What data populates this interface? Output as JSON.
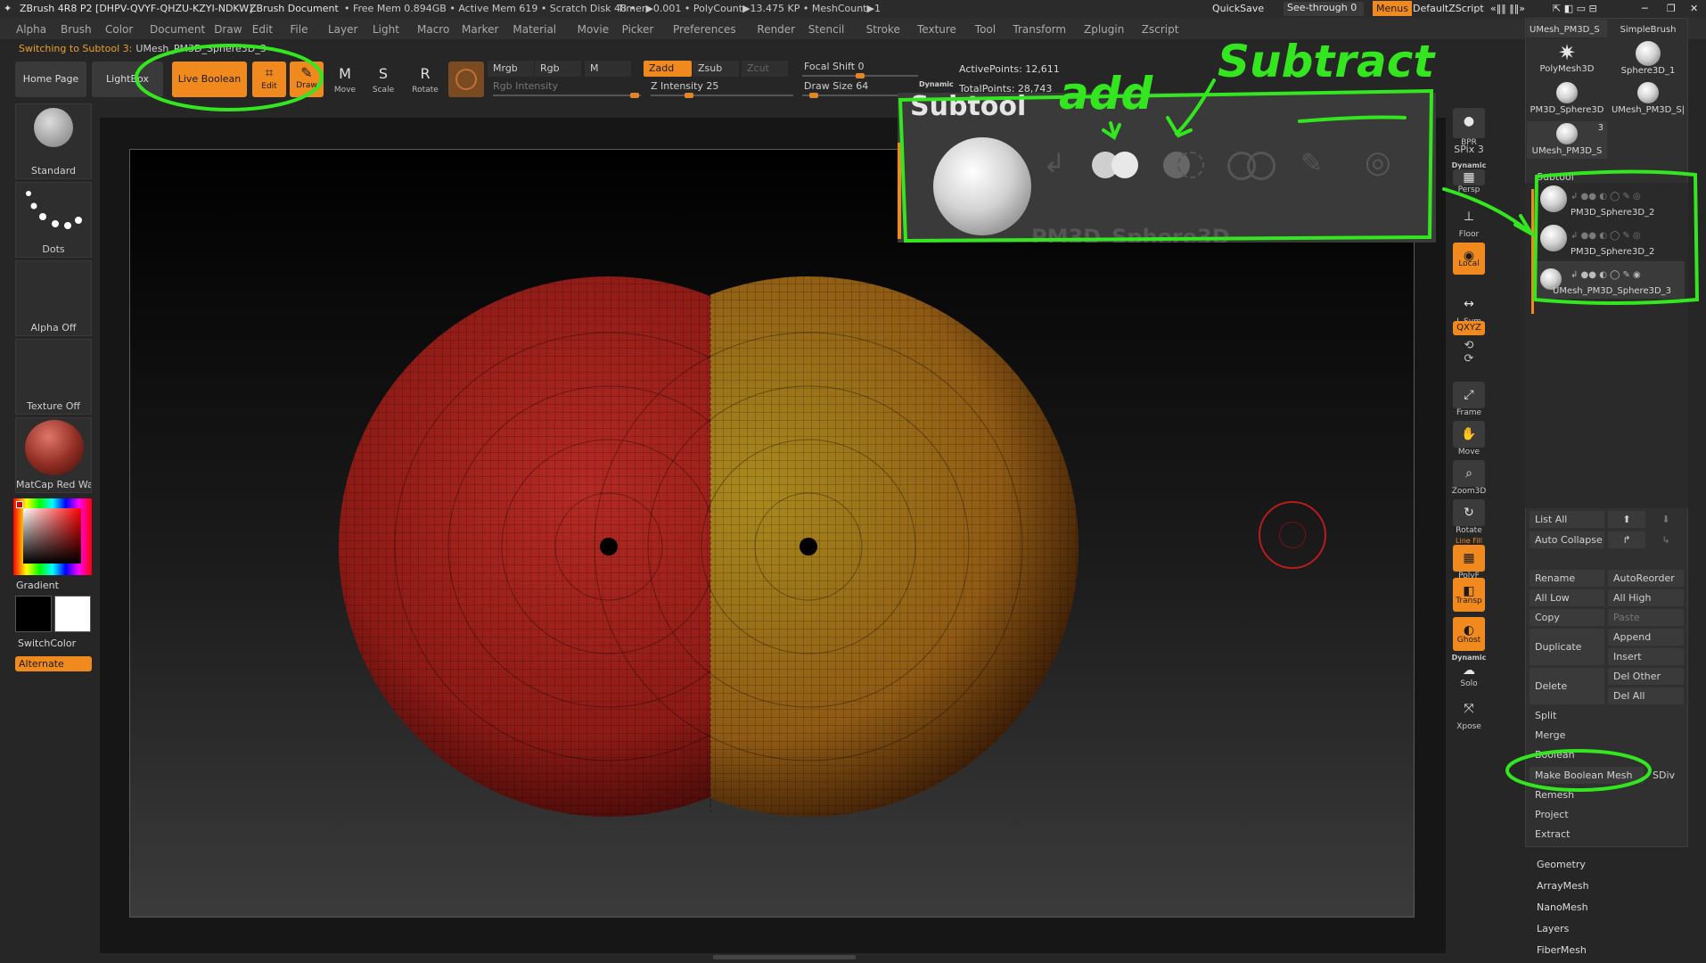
{
  "titlebar": {
    "app": "ZBrush 4R8 P2 [DHPV-QVYF-QHZU-KZYI-NDKW]",
    "doc": "ZBrush Document",
    "stats": "• Free Mem 0.894GB • Active Mem 619 • Scratch Disk 48 •",
    "timer": "Timer▶0.001 • PolyCount▶13.475 KP • MeshCount▶1",
    "quicksave": "QuickSave",
    "see_through": "See-through  0",
    "menus": "Menus",
    "default_zscript": "DefaultZScript"
  },
  "menubar": [
    "Alpha",
    "Brush",
    "Color",
    "Document",
    "Draw",
    "Edit",
    "File",
    "Layer",
    "Light",
    "Macro",
    "Marker",
    "Material",
    "Movie",
    "Picker",
    "Preferences",
    "Render",
    "Stencil",
    "Stroke",
    "Texture",
    "Tool",
    "Transform",
    "Zplugin",
    "Zscript"
  ],
  "notify": {
    "text": "Switching to Subtool 3:",
    "name": "UMesh_PM3D_Sphere3D_3"
  },
  "shelf": {
    "home_page": "Home Page",
    "lightbox": "LightBox",
    "live_boolean": "Live Boolean",
    "edit": "Edit",
    "draw": "Draw",
    "move": "Move",
    "scale": "Scale",
    "rotate": "Rotate",
    "mrgb": "Mrgb",
    "rgb": "Rgb",
    "m": "M",
    "rgb_intensity": "Rgb Intensity",
    "zadd": "Zadd",
    "zsub": "Zsub",
    "zcut": "Zcut",
    "z_intensity": "Z Intensity 25",
    "focal_shift": "Focal Shift 0",
    "draw_size": "Draw Size 64",
    "dynamic": "Dynamic",
    "active_points": "ActivePoints: 12,611",
    "total_points": "TotalPoints: 28,743",
    "z_intensity_value": 25,
    "focal_shift_value": 0,
    "draw_size_value": 64
  },
  "left_tray": {
    "brush": "Standard",
    "stroke": "Dots",
    "alpha": "Alpha Off",
    "texture": "Texture Off",
    "material": "MatCap Red Wa:",
    "gradient": "Gradient",
    "switch_color": "SwitchColor",
    "alternate": "Alternate"
  },
  "right_shelf": {
    "bpr": "BPR",
    "spix": "SPix 3",
    "dynamic": "Dynamic",
    "persp": "Persp",
    "floor": "Floor",
    "local": "Local",
    "lsym": "L.Sym",
    "xyz": "QXYZ",
    "frame": "Frame",
    "move": "Move",
    "zoom3d": "Zoom3D",
    "rotate": "Rotate",
    "linefill": "Line Fill",
    "polyf": "PolyF",
    "transp": "Transp",
    "ghost": "Ghost",
    "dynamic2": "Dynamic",
    "solo": "Solo",
    "xpose": "Xpose"
  },
  "tool_palette": {
    "items": [
      "UMesh_PM3D_S",
      "SimpleBrush",
      "PolyMesh3D",
      "Sphere3D_1",
      "PM3D_Sphere3D",
      "UMesh_PM3D_S|",
      "UMesh_PM3D_S"
    ],
    "count_badge": "3"
  },
  "subtool": {
    "title": "Subtool",
    "rows": [
      "PM3D_Sphere3D_2",
      "PM3D_Sphere3D_2",
      "UMesh_PM3D_Sphere3D_3"
    ],
    "list_all": "List All",
    "auto_collapse": "Auto Collapse",
    "rename": "Rename",
    "auto_reorder": "AutoReorder",
    "all_low": "All Low",
    "all_high": "All High",
    "copy": "Copy",
    "paste": "Paste",
    "append": "Append",
    "duplicate": "Duplicate",
    "insert": "Insert",
    "delete": "Delete",
    "del_other": "Del Other",
    "del_all": "Del All",
    "split": "Split",
    "merge": "Merge",
    "boolean": "Boolean",
    "make_boolean_mesh": "Make Boolean Mesh",
    "sdiv": "SDiv",
    "remesh": "Remesh",
    "project": "Project",
    "extract": "Extract"
  },
  "sections": [
    "Geometry",
    "ArrayMesh",
    "NanoMesh",
    "Layers",
    "FiberMesh"
  ],
  "callout": {
    "title": "Subtool",
    "bottom_text": "PM3D_Sphere3D_",
    "annot_add": "add",
    "annot_subtract": "Subtract"
  },
  "colors": {
    "accent": "#f08a1e",
    "annotation": "#33e61f",
    "left_sphere": "#b0261f",
    "right_sphere": "#b08a1e"
  }
}
